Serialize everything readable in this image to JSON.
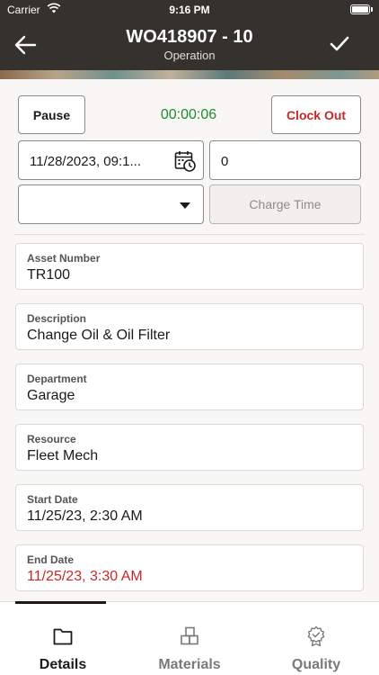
{
  "status": {
    "carrier": "Carrier",
    "time": "9:16 PM"
  },
  "nav": {
    "title": "WO418907 - 10",
    "subtitle": "Operation"
  },
  "controls": {
    "pause_label": "Pause",
    "timer": "00:00:06",
    "clock_out_label": "Clock Out",
    "date_value": "11/28/2023, 09:1...",
    "quantity_value": "0",
    "select_value": "",
    "charge_time_label": "Charge Time"
  },
  "details": [
    {
      "label": "Asset Number",
      "value": "TR100"
    },
    {
      "label": "Description",
      "value": "Change Oil & Oil Filter"
    },
    {
      "label": "Department",
      "value": "Garage"
    },
    {
      "label": "Resource",
      "value": "Fleet Mech"
    },
    {
      "label": "Start Date",
      "value": "11/25/23, 2:30 AM"
    },
    {
      "label": "End Date",
      "value": "11/25/23, 3:30 AM"
    }
  ],
  "tabs": [
    {
      "label": "Details",
      "icon": "folder-icon"
    },
    {
      "label": "Materials",
      "icon": "materials-icon"
    },
    {
      "label": "Quality",
      "icon": "quality-badge-icon"
    }
  ],
  "colors": {
    "header": "#35312d",
    "timer": "#1f8a2c",
    "clock_out": "#c62828",
    "end_date": "#c62828"
  }
}
